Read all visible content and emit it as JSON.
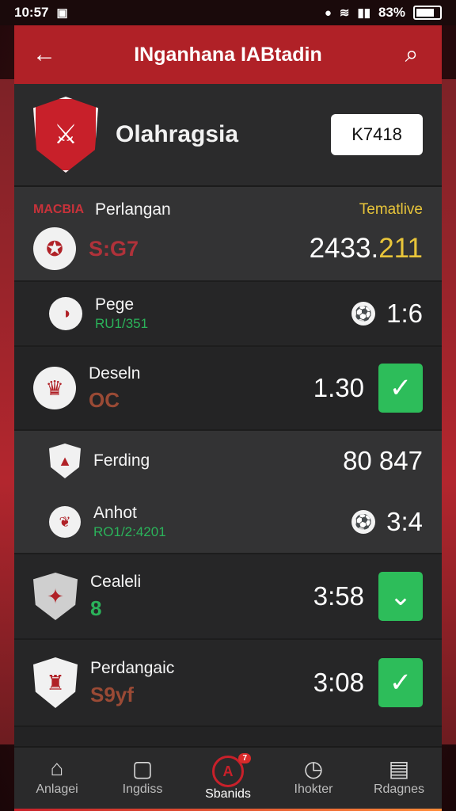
{
  "status_bar": {
    "time": "10:57",
    "battery": "83%"
  },
  "app_bar": {
    "title": "INganhana IABtadin"
  },
  "header": {
    "club_name": "Olahragsia",
    "code": "K7418"
  },
  "matches": [
    {
      "tag": "MACBIA",
      "name": "Perlangan",
      "status": "Tematlive",
      "sub": "S:G7",
      "score_white": "2433.",
      "score_yellow": "211"
    },
    {
      "name": "Pege",
      "sub": "RU1/351",
      "score": "1:6"
    },
    {
      "name": "Deseln",
      "sub": "OC",
      "score": "1.30"
    },
    {
      "name": "Ferding",
      "score": "80 847"
    },
    {
      "name": "Anhot",
      "sub": "RO1/2:4201",
      "score": "3:4"
    },
    {
      "name": "Cealeli",
      "sub": "8",
      "score": "3:58"
    },
    {
      "name": "Perdangaic",
      "sub": "S9yf",
      "score": "3:08"
    }
  ],
  "nav": [
    {
      "label": "Anlagei",
      "icon": "home-icon"
    },
    {
      "label": "Ingdiss",
      "icon": "calendar-icon"
    },
    {
      "label": "Sbanids",
      "icon": "sports-icon",
      "badge": "7"
    },
    {
      "label": "Ihokter",
      "icon": "clock-icon"
    },
    {
      "label": "Rdagnes",
      "icon": "news-icon"
    }
  ],
  "colors": {
    "primary": "#b02127",
    "accent": "#2dbd5a",
    "highlight": "#e8c53a"
  }
}
